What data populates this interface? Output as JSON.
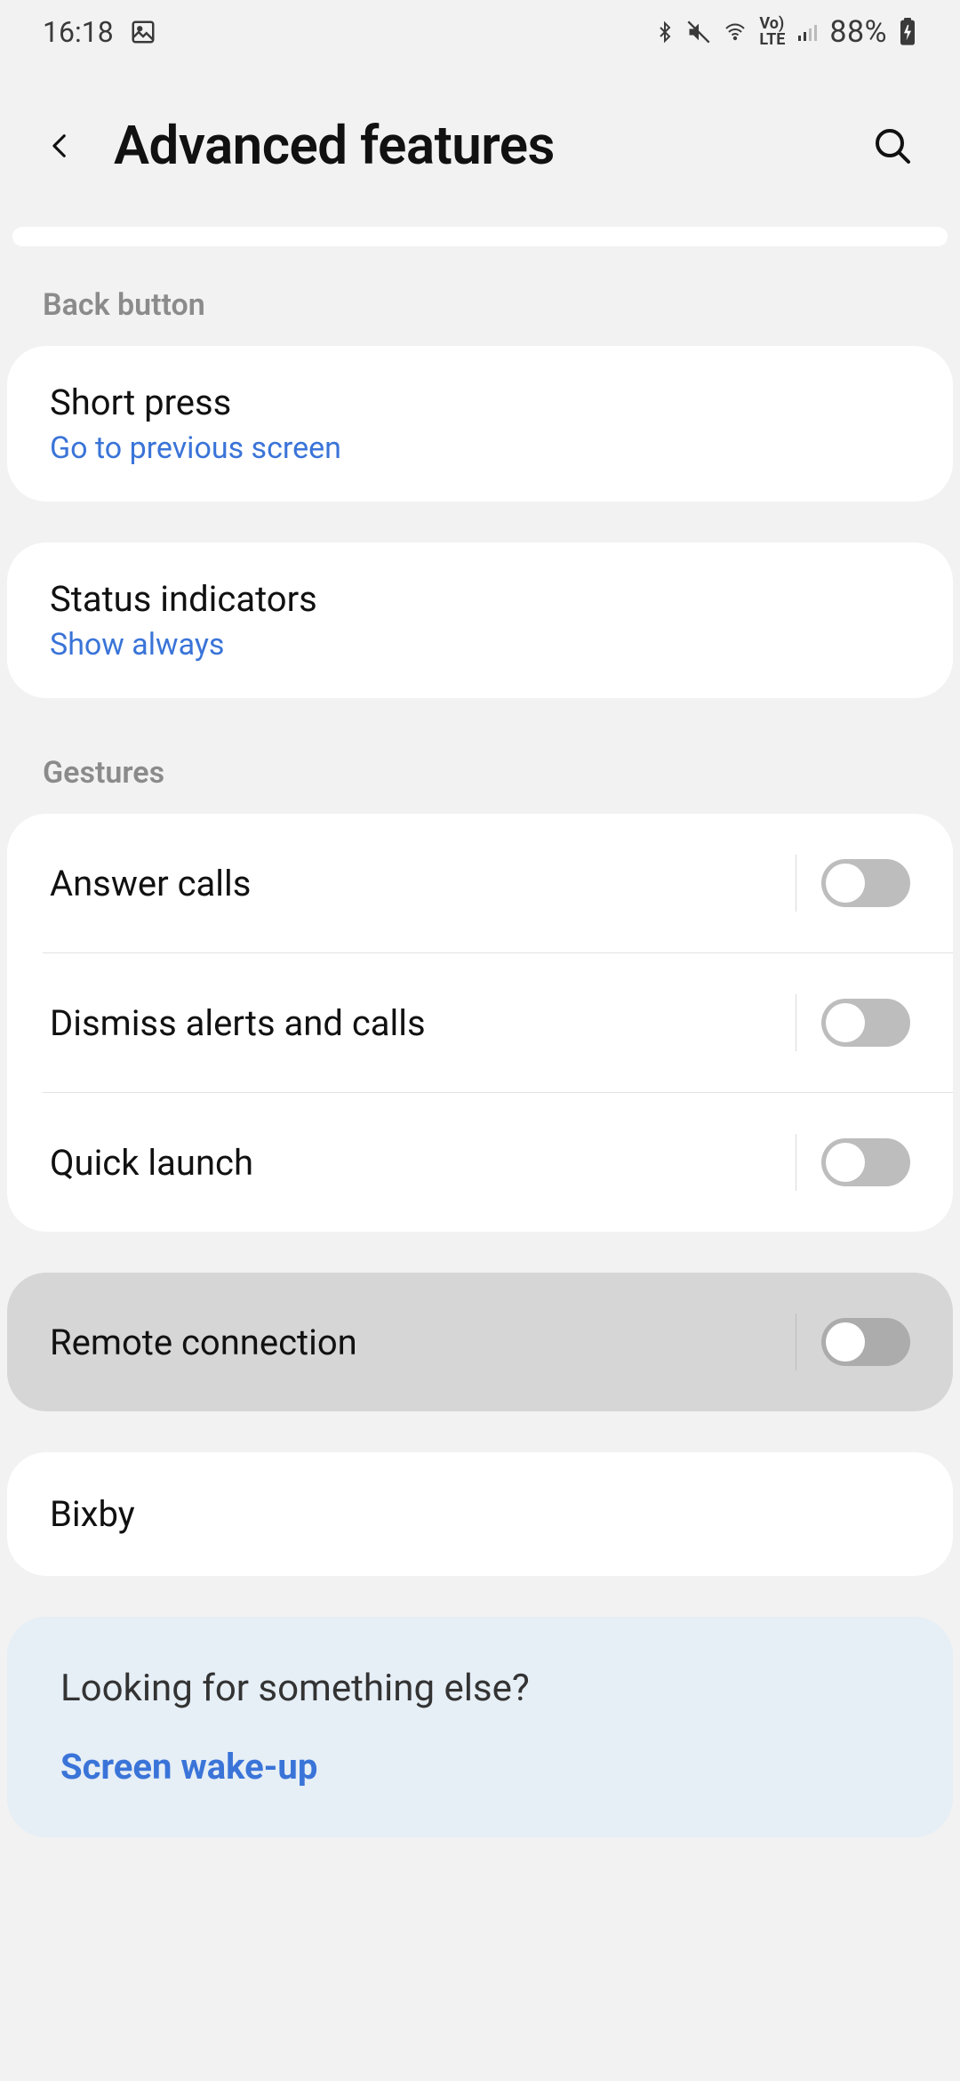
{
  "status_bar": {
    "time": "16:18",
    "battery": "88%"
  },
  "header": {
    "title": "Advanced features"
  },
  "sections": {
    "back_button_label": "Back button",
    "gestures_label": "Gestures"
  },
  "short_press": {
    "title": "Short press",
    "value": "Go to previous screen"
  },
  "status_indicators": {
    "title": "Status indicators",
    "value": "Show always"
  },
  "gestures": {
    "answer_calls": "Answer calls",
    "dismiss": "Dismiss alerts and calls",
    "quick_launch": "Quick launch"
  },
  "remote_connection": {
    "title": "Remote connection"
  },
  "bixby": {
    "title": "Bixby"
  },
  "footer": {
    "prompt": "Looking for something else?",
    "link": "Screen wake-up"
  }
}
